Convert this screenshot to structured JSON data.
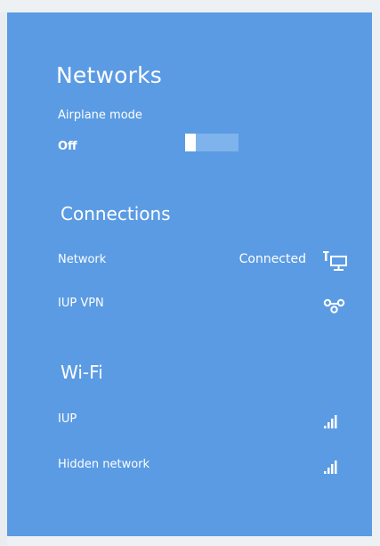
{
  "panel": {
    "title": "Networks",
    "background_color": "#5b9be3",
    "airplane_mode": {
      "label": "Airplane mode",
      "state": "Off",
      "enabled": false
    }
  },
  "sections": {
    "connections": {
      "heading": "Connections",
      "items": [
        {
          "label": "Network",
          "status": "Connected",
          "icon": "wired-network-icon"
        },
        {
          "label": "IUP VPN",
          "status": "",
          "icon": "vpn-icon"
        }
      ]
    },
    "wifi": {
      "heading": "Wi-Fi",
      "items": [
        {
          "label": "IUP",
          "icon": "wifi-signal-icon",
          "signal_bars": 4
        },
        {
          "label": "Hidden network",
          "icon": "wifi-signal-icon",
          "signal_bars": 4
        }
      ]
    }
  }
}
